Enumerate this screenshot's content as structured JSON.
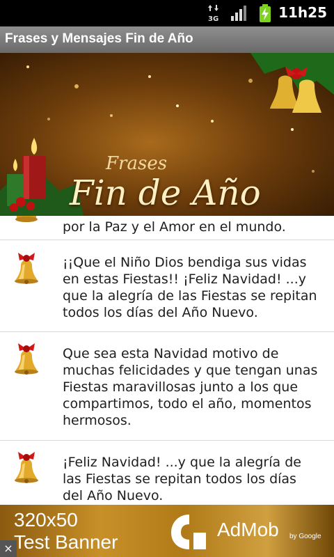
{
  "status_bar": {
    "time": "11h25",
    "network_label": "3G",
    "icons": [
      "network-3g-icon",
      "signal-icon",
      "battery-charging-icon"
    ]
  },
  "app": {
    "title": "Frases y Mensajes Fin de Año"
  },
  "banner": {
    "subtitle": "Frases",
    "title": "Fin de Año"
  },
  "messages": [
    {
      "text": "por la Paz y el Amor en el mundo.",
      "icon": "bell-icon"
    },
    {
      "text": "¡¡Que el Niño Dios bendiga sus vidas en estas Fiestas!! ¡Feliz Navidad! ...y que la alegría de las Fiestas se repitan todos los días del Año Nuevo.",
      "icon": "bell-icon"
    },
    {
      "text": "Que sea esta Navidad motivo de muchas felicidades y que tengan unas Fiestas maravillosas junto a los que compartimos, todo el año, momentos hermosos.",
      "icon": "bell-icon"
    },
    {
      "text": "¡Feliz Navidad! ...y que la alegría de las Fiestas se repitan todos los días del Año Nuevo.",
      "icon": "bell-icon"
    }
  ],
  "ad": {
    "line1": "320x50",
    "line2": "Test Banner",
    "brand": "AdMob",
    "by": "by Google",
    "close": "×"
  }
}
